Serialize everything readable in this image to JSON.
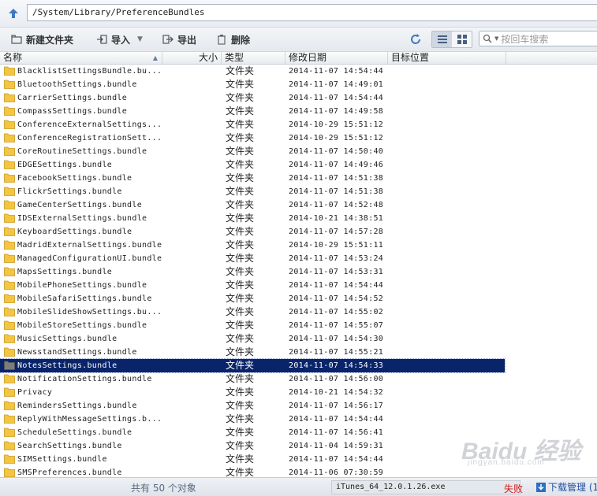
{
  "address": {
    "path": "/System/Library/PreferenceBundles"
  },
  "toolbar": {
    "new_folder": "新建文件夹",
    "import": "导入",
    "export": "导出",
    "delete": "删除",
    "search_placeholder": "按回车搜索"
  },
  "columns": {
    "name": "名称",
    "size": "大小",
    "type": "类型",
    "date": "修改日期",
    "target": "目标位置"
  },
  "rows": [
    {
      "name": "BlacklistSettingsBundle.bu...",
      "type": "文件夹",
      "date": "2014-11-07 14:54:44"
    },
    {
      "name": "BluetoothSettings.bundle",
      "type": "文件夹",
      "date": "2014-11-07 14:49:01"
    },
    {
      "name": "CarrierSettings.bundle",
      "type": "文件夹",
      "date": "2014-11-07 14:54:44"
    },
    {
      "name": "CompassSettings.bundle",
      "type": "文件夹",
      "date": "2014-11-07 14:49:58"
    },
    {
      "name": "ConferenceExternalSettings...",
      "type": "文件夹",
      "date": "2014-10-29 15:51:12"
    },
    {
      "name": "ConferenceRegistrationSett...",
      "type": "文件夹",
      "date": "2014-10-29 15:51:12"
    },
    {
      "name": "CoreRoutineSettings.bundle",
      "type": "文件夹",
      "date": "2014-11-07 14:50:40"
    },
    {
      "name": "EDGESettings.bundle",
      "type": "文件夹",
      "date": "2014-11-07 14:49:46"
    },
    {
      "name": "FacebookSettings.bundle",
      "type": "文件夹",
      "date": "2014-11-07 14:51:38"
    },
    {
      "name": "FlickrSettings.bundle",
      "type": "文件夹",
      "date": "2014-11-07 14:51:38"
    },
    {
      "name": "GameCenterSettings.bundle",
      "type": "文件夹",
      "date": "2014-11-07 14:52:48"
    },
    {
      "name": "IDSExternalSettings.bundle",
      "type": "文件夹",
      "date": "2014-10-21 14:38:51"
    },
    {
      "name": "KeyboardSettings.bundle",
      "type": "文件夹",
      "date": "2014-11-07 14:57:28"
    },
    {
      "name": "MadridExternalSettings.bundle",
      "type": "文件夹",
      "date": "2014-10-29 15:51:11"
    },
    {
      "name": "ManagedConfigurationUI.bundle",
      "type": "文件夹",
      "date": "2014-11-07 14:53:24"
    },
    {
      "name": "MapsSettings.bundle",
      "type": "文件夹",
      "date": "2014-11-07 14:53:31"
    },
    {
      "name": "MobilePhoneSettings.bundle",
      "type": "文件夹",
      "date": "2014-11-07 14:54:44"
    },
    {
      "name": "MobileSafariSettings.bundle",
      "type": "文件夹",
      "date": "2014-11-07 14:54:52"
    },
    {
      "name": "MobileSlideShowSettings.bu...",
      "type": "文件夹",
      "date": "2014-11-07 14:55:02"
    },
    {
      "name": "MobileStoreSettings.bundle",
      "type": "文件夹",
      "date": "2014-11-07 14:55:07"
    },
    {
      "name": "MusicSettings.bundle",
      "type": "文件夹",
      "date": "2014-11-07 14:54:30"
    },
    {
      "name": "NewsstandSettings.bundle",
      "type": "文件夹",
      "date": "2014-11-07 14:55:21"
    },
    {
      "name": "NotesSettings.bundle",
      "type": "文件夹",
      "date": "2014-11-07 14:54:33",
      "selected": true
    },
    {
      "name": "NotificationSettings.bundle",
      "type": "文件夹",
      "date": "2014-11-07 14:56:00"
    },
    {
      "name": "Privacy",
      "type": "文件夹",
      "date": "2014-10-21 14:54:32"
    },
    {
      "name": "RemindersSettings.bundle",
      "type": "文件夹",
      "date": "2014-11-07 14:56:17"
    },
    {
      "name": "ReplyWithMessageSettings.b...",
      "type": "文件夹",
      "date": "2014-11-07 14:54:44"
    },
    {
      "name": "ScheduleSettings.bundle",
      "type": "文件夹",
      "date": "2014-11-07 14:56:41"
    },
    {
      "name": "SearchSettings.bundle",
      "type": "文件夹",
      "date": "2014-11-04 14:59:31"
    },
    {
      "name": "SIMSettings.bundle",
      "type": "文件夹",
      "date": "2014-11-07 14:54:44"
    },
    {
      "name": "SMSPreferences.bundle",
      "type": "文件夹",
      "date": "2014-11-06 07:30:59"
    }
  ],
  "status": {
    "count": "共有 50 个对象",
    "download_file": "iTunes_64_12.0.1.26.exe",
    "download_status": "失败",
    "download_manager": "下载管理 (1"
  },
  "watermark": {
    "brand": "Baidu 经验",
    "url": "jingyan.baidu.com"
  },
  "colors": {
    "selection": "#0a246a",
    "folder": "#f4c542",
    "fail": "#d21b1b"
  }
}
